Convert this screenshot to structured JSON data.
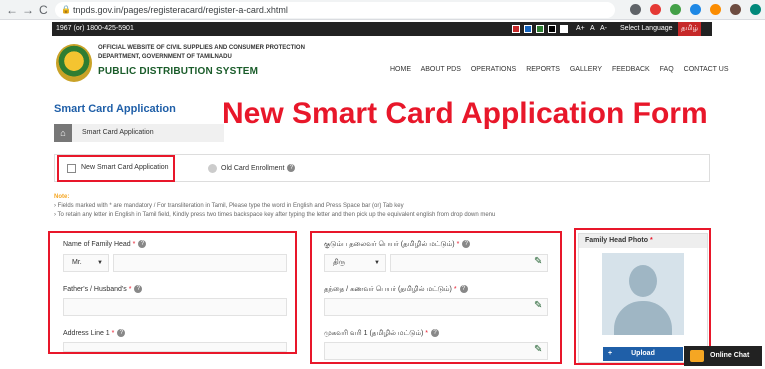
{
  "browser": {
    "url": "tnpds.gov.in/pages/registeracard/register-a-card.xhtml",
    "nav_back": "←",
    "nav_forward": "→",
    "nav_reload": "C"
  },
  "topbar": {
    "phone": "1967 (or) 1800-425-5901",
    "font_controls": [
      "A+",
      "A",
      "A-"
    ],
    "select_language": "Select Language",
    "tamil": "தமிழ்"
  },
  "header": {
    "org_line1": "OFFICIAL WEBSITE OF CIVIL SUPPLIES AND CONSUMER PROTECTION",
    "org_line2": "DEPARTMENT, GOVERNMENT OF TAMILNADU",
    "title": "PUBLIC DISTRIBUTION SYSTEM",
    "menu": [
      "HOME",
      "ABOUT PDS",
      "OPERATIONS",
      "REPORTS",
      "GALLERY",
      "FEEDBACK",
      "FAQ",
      "CONTACT US"
    ]
  },
  "page": {
    "title": "Smart Card Application",
    "overlay_title": "New Smart Card Application Form",
    "breadcrumb": "Smart Card Application"
  },
  "options": {
    "new_card": "New Smart Card Application",
    "old_card": "Old Card Enrollment"
  },
  "notes": {
    "label": "Note:",
    "line1": "› Fields marked with  * are mandatory  / For transliteration in Tamil, Please type the word in English and Press Space bar (or) Tab key",
    "line2": "› To retain any letter in English in Tamil field, Kindly press two times backspace key after typing the letter and then pick up the equivalent english from drop down menu"
  },
  "form_en": {
    "family_head_label": "Name of Family Head",
    "title_select": "Mr.",
    "father_label": "Father's / Husband's",
    "address_label": "Address Line 1"
  },
  "form_ta": {
    "family_head_label": "குடும்ப தலைவர் பெயர் (தமிழில் மட்டும்)",
    "title_select": "திரு",
    "father_label": "தந்தை / கணவர் பெயர் (தமிழில் மட்டும்)",
    "address_label": "முகவரி வரி 1 (தமிழில் மட்டும்)"
  },
  "photo": {
    "label": "Family Head Photo",
    "upload": "Upload"
  },
  "chat": {
    "label": "Online Chat"
  },
  "colors": {
    "accent_red": "#e8172a",
    "brand_blue": "#1f5fa8",
    "brand_green": "#1a5c2a"
  }
}
